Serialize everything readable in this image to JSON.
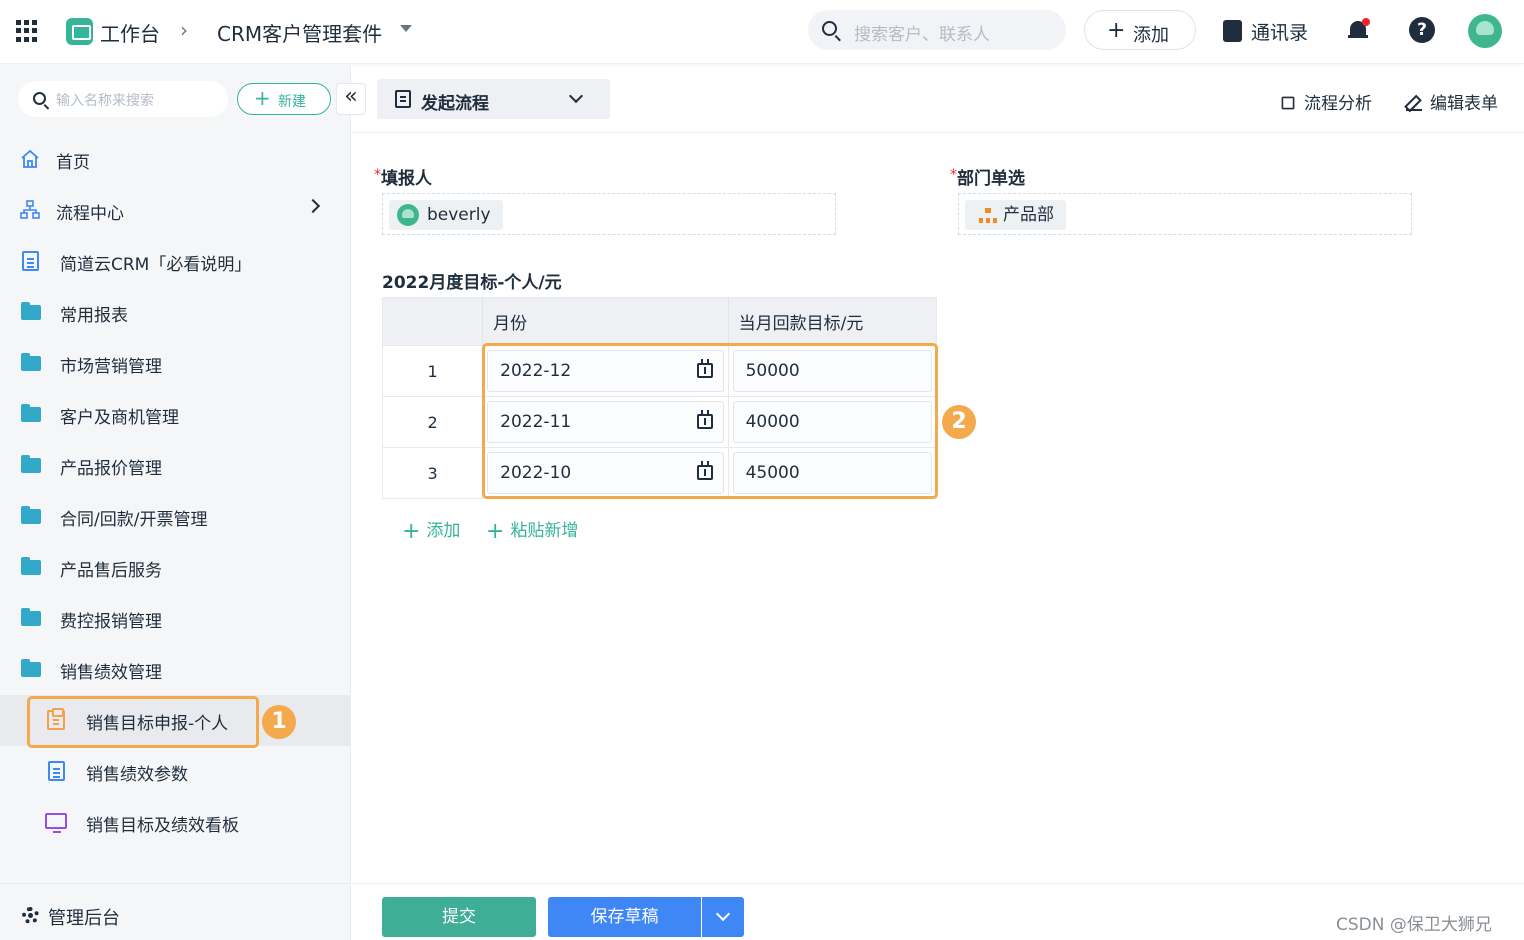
{
  "topbar": {
    "workspace": "工作台",
    "separator": "›",
    "app_name": "CRM客户管理套件",
    "search_placeholder": "搜索客户、联系人",
    "add_label": "添加",
    "contacts_label": "通讯录",
    "help_label": "?"
  },
  "sidebar": {
    "search_placeholder": "输入名称来搜索",
    "new_label": "新建",
    "collapse_label": "«",
    "items": [
      {
        "label": "首页",
        "icon": "home-icon"
      },
      {
        "label": "流程中心",
        "icon": "flow-icon"
      },
      {
        "label": "简道云CRM「必看说明」",
        "icon": "doc-icon"
      },
      {
        "label": "常用报表",
        "icon": "folder-icon"
      },
      {
        "label": "市场营销管理",
        "icon": "folder-icon"
      },
      {
        "label": "客户及商机管理",
        "icon": "folder-icon"
      },
      {
        "label": "产品报价管理",
        "icon": "folder-icon"
      },
      {
        "label": "合同/回款/开票管理",
        "icon": "folder-icon"
      },
      {
        "label": "产品售后服务",
        "icon": "folder-icon"
      },
      {
        "label": "费控报销管理",
        "icon": "folder-icon"
      },
      {
        "label": "销售绩效管理",
        "icon": "folder-icon"
      }
    ],
    "sub_items": [
      {
        "label": "销售目标申报-个人",
        "icon": "clipboard-icon",
        "active": true
      },
      {
        "label": "销售绩效参数",
        "icon": "doc-icon"
      },
      {
        "label": "销售目标及绩效看板",
        "icon": "dashboard-icon"
      }
    ],
    "footer_label": "管理后台",
    "badge_1": "1"
  },
  "header": {
    "flow_select": "发起流程",
    "action_analysis": "流程分析",
    "action_edit": "编辑表单"
  },
  "form": {
    "filler_label": "填报人",
    "filler_value": "beverly",
    "dept_label": "部门单选",
    "dept_value": "产品部",
    "subform_title": "2022月度目标-个人/元",
    "col_month": "月份",
    "col_target": "当月回款目标/元",
    "rows": [
      {
        "index": "1",
        "month": "2022-12",
        "target": "50000"
      },
      {
        "index": "2",
        "month": "2022-11",
        "target": "40000"
      },
      {
        "index": "3",
        "month": "2022-10",
        "target": "45000"
      }
    ],
    "add_row": "添加",
    "paste_add": "粘贴新增",
    "badge_2": "2"
  },
  "footer": {
    "submit": "提交",
    "save_draft": "保存草稿"
  },
  "watermark": "CSDN @保卫大狮兄",
  "colors": {
    "accent_green": "#34b49a",
    "primary_blue": "#3f87f5",
    "highlight_orange": "#f4a94c"
  }
}
